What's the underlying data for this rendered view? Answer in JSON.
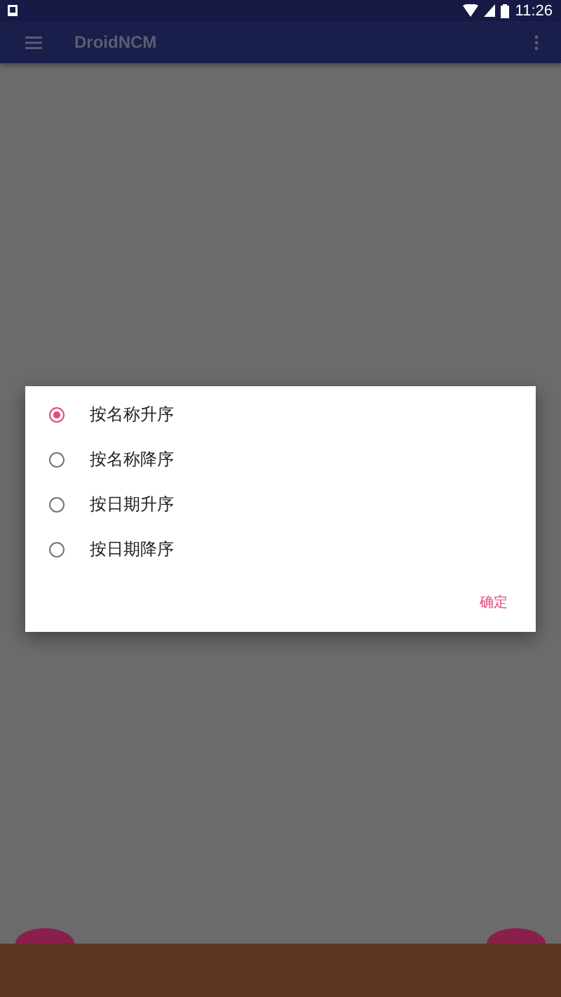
{
  "status_bar": {
    "time": "11:26"
  },
  "toolbar": {
    "title": "DroidNCM"
  },
  "sort_dialog": {
    "options": [
      {
        "label": "按名称升序",
        "selected": true
      },
      {
        "label": "按名称降序",
        "selected": false
      },
      {
        "label": "按日期升序",
        "selected": false
      },
      {
        "label": "按日期降序",
        "selected": false
      }
    ],
    "confirm_button": "确定"
  }
}
